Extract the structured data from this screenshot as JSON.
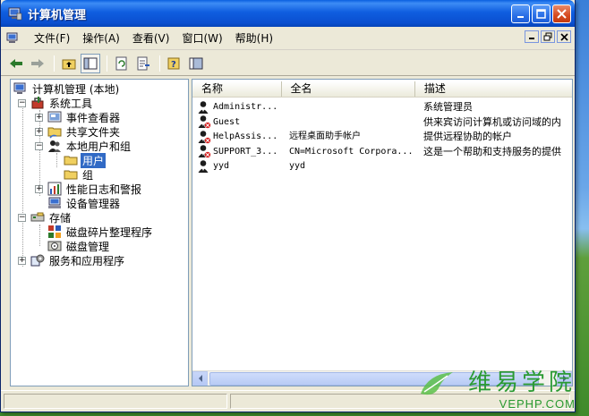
{
  "window": {
    "title": "计算机管理"
  },
  "menu": {
    "items": [
      "文件(F)",
      "操作(A)",
      "查看(V)",
      "窗口(W)",
      "帮助(H)"
    ]
  },
  "tree": {
    "root": "计算机管理 (本地)",
    "system_tools": "系统工具",
    "event_viewer": "事件查看器",
    "shared_folders": "共享文件夹",
    "local_users": "本地用户和组",
    "users": "用户",
    "groups": "组",
    "perf_logs": "性能日志和警报",
    "device_manager": "设备管理器",
    "storage": "存储",
    "defrag": "磁盘碎片整理程序",
    "disk_mgmt": "磁盘管理",
    "services": "服务和应用程序"
  },
  "list": {
    "columns": [
      "名称",
      "全名",
      "描述"
    ],
    "rows": [
      {
        "name": "Administr...",
        "fullname": "",
        "desc": "系统管理员",
        "disabled": false
      },
      {
        "name": "Guest",
        "fullname": "",
        "desc": "供来宾访问计算机或访问域的内",
        "disabled": true
      },
      {
        "name": "HelpAssis...",
        "fullname": "远程桌面助手帐户",
        "desc": "提供远程协助的帐户",
        "disabled": true
      },
      {
        "name": "SUPPORT_3...",
        "fullname": "CN=Microsoft Corpora...",
        "desc": "这是一个帮助和支持服务的提供",
        "disabled": true
      },
      {
        "name": "yyd",
        "fullname": "yyd",
        "desc": "",
        "disabled": false
      }
    ]
  },
  "watermark": {
    "cn": "维易学院",
    "en": "VEPHP.COM"
  },
  "colors": {
    "titlebar": "#0a5fe0",
    "selection": "#316ac5",
    "window_bg": "#ece9d8"
  }
}
